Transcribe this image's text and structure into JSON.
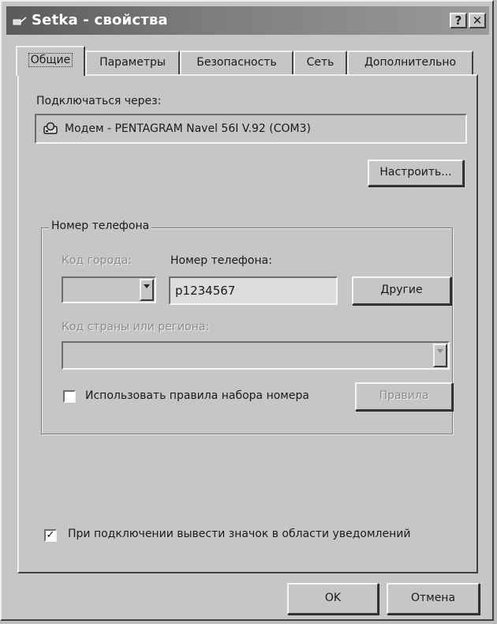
{
  "window": {
    "title": "Setka - свойства",
    "help_glyph": "?",
    "close_glyph": "✕"
  },
  "tabs": [
    {
      "label": "Общие",
      "active": true
    },
    {
      "label": "Параметры",
      "active": false
    },
    {
      "label": "Безопасность",
      "active": false
    },
    {
      "label": "Сеть",
      "active": false
    },
    {
      "label": "Дополнительно",
      "active": false
    }
  ],
  "general": {
    "connect_via_label": "Подключаться через:",
    "device_icon": "modem-icon",
    "device_name": "Модем - PENTAGRAM Navel 56I V.92 (COM3)",
    "configure_button": "Настроить...",
    "phone_group": {
      "title": "Номер телефона",
      "area_code_label": "Код города:",
      "area_code_value": "",
      "phone_label": "Номер телефона:",
      "phone_value": "p1234567",
      "other_button": "Другие",
      "country_label": "Код страны или региона:",
      "country_value": "",
      "use_dialing_rules_label": "Использовать правила набора номера",
      "use_dialing_rules_checked": false,
      "rules_button": "Правила"
    },
    "show_icon_label": "При подключении вывести значок в области уведомлений",
    "show_icon_checked": true,
    "show_icon_check_glyph": "✓"
  },
  "footer": {
    "ok_button": "OK",
    "cancel_button": "Отмена"
  },
  "colors": {
    "face": "#c6c6c6",
    "titlebar_start": "#5a5a5a",
    "titlebar_end": "#9a9a9a",
    "disabled_text": "#8a8a8a"
  }
}
